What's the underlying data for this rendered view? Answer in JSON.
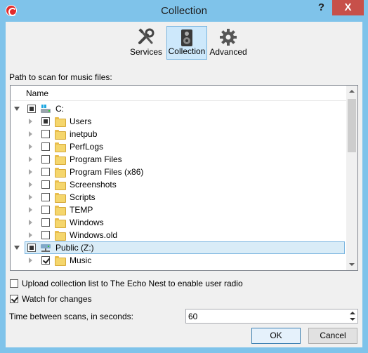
{
  "window": {
    "title": "Collection",
    "help_label": "?",
    "close_label": "X"
  },
  "tabs": [
    {
      "label": "Services",
      "icon": "tools-icon"
    },
    {
      "label": "Collection",
      "icon": "speaker-icon"
    },
    {
      "label": "Advanced",
      "icon": "gear-icon"
    }
  ],
  "path_label": "Path to scan for music files:",
  "tree": {
    "column_header": "Name",
    "rows": [
      {
        "label": "C:",
        "state": "partial",
        "expanded": true,
        "level": 0,
        "kind": "drive"
      },
      {
        "label": "Users",
        "state": "partial",
        "expanded": false,
        "level": 1,
        "kind": "folder"
      },
      {
        "label": "inetpub",
        "state": "unchecked",
        "expanded": false,
        "level": 1,
        "kind": "folder"
      },
      {
        "label": "PerfLogs",
        "state": "unchecked",
        "expanded": false,
        "level": 1,
        "kind": "folder"
      },
      {
        "label": "Program Files",
        "state": "unchecked",
        "expanded": false,
        "level": 1,
        "kind": "folder"
      },
      {
        "label": "Program Files (x86)",
        "state": "unchecked",
        "expanded": false,
        "level": 1,
        "kind": "folder"
      },
      {
        "label": "Screenshots",
        "state": "unchecked",
        "expanded": false,
        "level": 1,
        "kind": "folder"
      },
      {
        "label": "Scripts",
        "state": "unchecked",
        "expanded": false,
        "level": 1,
        "kind": "folder"
      },
      {
        "label": "TEMP",
        "state": "unchecked",
        "expanded": false,
        "level": 1,
        "kind": "folder"
      },
      {
        "label": "Windows",
        "state": "unchecked",
        "expanded": false,
        "level": 1,
        "kind": "folder"
      },
      {
        "label": "Windows.old",
        "state": "unchecked",
        "expanded": false,
        "level": 1,
        "kind": "folder"
      },
      {
        "label": "Public (Z:)",
        "state": "partial",
        "expanded": true,
        "level": 0,
        "kind": "network-drive",
        "selected": true
      },
      {
        "label": "Music",
        "state": "checked",
        "expanded": false,
        "level": 1,
        "kind": "folder"
      }
    ]
  },
  "options": {
    "upload_label": "Upload collection list to The Echo Nest to enable user radio",
    "upload_checked": false,
    "watch_label": "Watch for changes",
    "watch_checked": true
  },
  "scan": {
    "label": "Time between scans, in seconds:",
    "value": "60"
  },
  "buttons": {
    "ok": "OK",
    "cancel": "Cancel"
  },
  "colors": {
    "titlebar": "#7fc3ea",
    "close_button": "#c7504a",
    "selection": "#d9ecf7"
  }
}
